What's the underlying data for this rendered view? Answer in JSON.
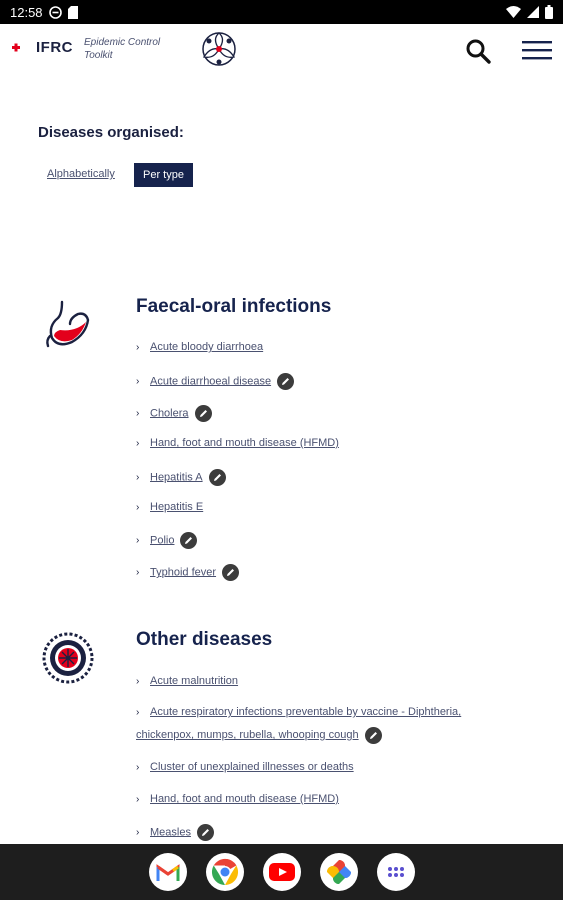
{
  "status_bar": {
    "time": "12:58"
  },
  "header": {
    "logo_text": "IFRC",
    "toolkit_title": "Epidemic Control Toolkit",
    "brand_color": "#e3001b",
    "search_icon": "search-icon",
    "menu_icon": "hamburger-menu-icon"
  },
  "filter": {
    "heading": "Diseases organised:",
    "options": [
      "Alphabetically",
      "Per type"
    ],
    "selected": "Per type"
  },
  "sections": [
    {
      "title": "Faecal-oral infections",
      "icon": "stomach-icon",
      "items": [
        {
          "label": "Acute bloody diarrhoea",
          "has_edit": false
        },
        {
          "label": "Acute diarrhoeal disease",
          "has_edit": true
        },
        {
          "label": "Cholera",
          "has_edit": true
        },
        {
          "label": "Hand, foot and mouth disease (HFMD)",
          "has_edit": false
        },
        {
          "label": "Hepatitis A",
          "has_edit": true
        },
        {
          "label": "Hepatitis E",
          "has_edit": false
        },
        {
          "label": "Polio",
          "has_edit": true
        },
        {
          "label": "Typhoid fever",
          "has_edit": true
        }
      ]
    },
    {
      "title": "Other diseases",
      "icon": "virus-icon",
      "items": [
        {
          "label": "Acute malnutrition",
          "has_edit": false
        },
        {
          "label": "Acute respiratory infections preventable by vaccine - Diphtheria, chickenpox, mumps, rubella, whooping cough",
          "has_edit": true
        },
        {
          "label": "Cluster of unexplained illnesses or deaths",
          "has_edit": false
        },
        {
          "label": "Hand, foot and mouth disease (HFMD)",
          "has_edit": false
        },
        {
          "label": "Measles",
          "has_edit": true
        }
      ]
    }
  ],
  "dock": [
    "gmail-icon",
    "chrome-icon",
    "youtube-icon",
    "photos-icon",
    "apps-drawer-icon"
  ]
}
